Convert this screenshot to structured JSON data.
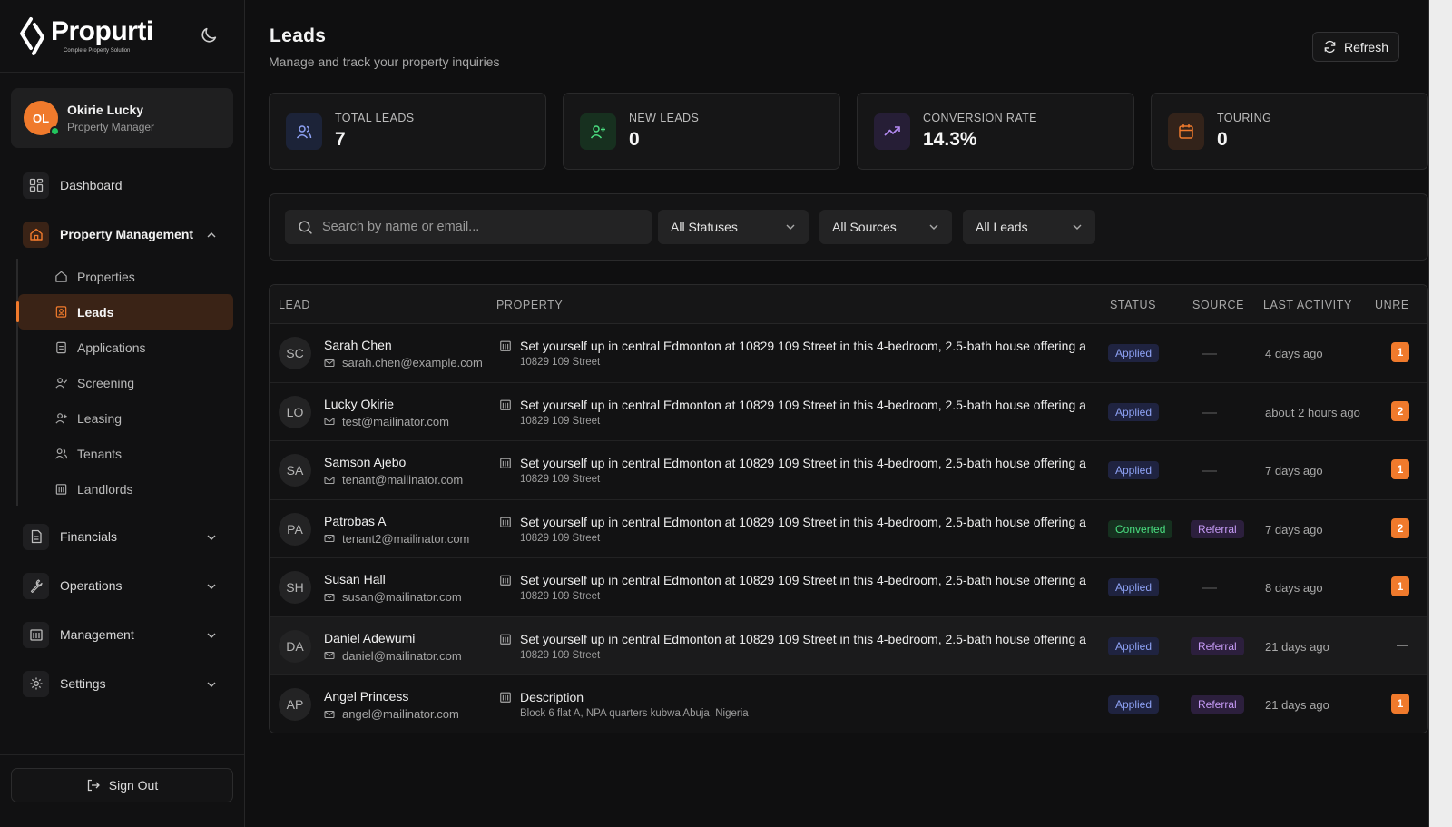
{
  "brand": {
    "name": "Propurti",
    "tagline": "Complete Property Solution"
  },
  "user": {
    "initials": "OL",
    "name": "Okirie Lucky",
    "role": "Property Manager"
  },
  "nav": {
    "dashboard": "Dashboard",
    "property_management": "Property Management",
    "sub": [
      "Properties",
      "Leads",
      "Applications",
      "Screening",
      "Leasing",
      "Tenants",
      "Landlords"
    ],
    "financials": "Financials",
    "operations": "Operations",
    "management": "Management",
    "settings": "Settings",
    "sign_out": "Sign Out"
  },
  "header": {
    "title": "Leads",
    "subtitle": "Manage and track your property inquiries",
    "refresh": "Refresh"
  },
  "stats": [
    {
      "label": "TOTAL LEADS",
      "value": "7",
      "color": "#8ea2f5"
    },
    {
      "label": "NEW LEADS",
      "value": "0",
      "color": "#4ade80"
    },
    {
      "label": "CONVERSION RATE",
      "value": "14.3%",
      "color": "#b68cf5"
    },
    {
      "label": "TOURING",
      "value": "0",
      "color": "#f07a2c"
    }
  ],
  "filters": {
    "search_placeholder": "Search by name or email...",
    "status": "All Statuses",
    "source": "All Sources",
    "leads": "All Leads"
  },
  "table": {
    "columns": [
      "LEAD",
      "PROPERTY",
      "STATUS",
      "SOURCE",
      "LAST ACTIVITY",
      "UNRE"
    ],
    "rows": [
      {
        "initials": "SC",
        "name": "Sarah Chen",
        "email": "sarah.chen@example.com",
        "property": "Set yourself up in central Edmonton at 10829 109 Street in this 4-bedroom, 2.5-bath house offering a",
        "address": "10829 109 Street",
        "status": "Applied",
        "source": "",
        "activity": "4 days ago",
        "unread": "1"
      },
      {
        "initials": "LO",
        "name": "Lucky Okirie",
        "email": "test@mailinator.com",
        "property": "Set yourself up in central Edmonton at 10829 109 Street in this 4-bedroom, 2.5-bath house offering a",
        "address": "10829 109 Street",
        "status": "Applied",
        "source": "",
        "activity": "about 2 hours ago",
        "unread": "2"
      },
      {
        "initials": "SA",
        "name": "Samson Ajebo",
        "email": "tenant@mailinator.com",
        "property": "Set yourself up in central Edmonton at 10829 109 Street in this 4-bedroom, 2.5-bath house offering a",
        "address": "10829 109 Street",
        "status": "Applied",
        "source": "",
        "activity": "7 days ago",
        "unread": "1"
      },
      {
        "initials": "PA",
        "name": "Patrobas A",
        "email": "tenant2@mailinator.com",
        "property": "Set yourself up in central Edmonton at 10829 109 Street in this 4-bedroom, 2.5-bath house offering a",
        "address": "10829 109 Street",
        "status": "Converted",
        "source": "Referral",
        "activity": "7 days ago",
        "unread": "2"
      },
      {
        "initials": "SH",
        "name": "Susan Hall",
        "email": "susan@mailinator.com",
        "property": "Set yourself up in central Edmonton at 10829 109 Street in this 4-bedroom, 2.5-bath house offering a",
        "address": "10829 109 Street",
        "status": "Applied",
        "source": "",
        "activity": "8 days ago",
        "unread": "1"
      },
      {
        "initials": "DA",
        "name": "Daniel Adewumi",
        "email": "daniel@mailinator.com",
        "property": "Set yourself up in central Edmonton at 10829 109 Street in this 4-bedroom, 2.5-bath house offering a",
        "address": "10829 109 Street",
        "status": "Applied",
        "source": "Referral",
        "activity": "21 days ago",
        "unread": "—"
      },
      {
        "initials": "AP",
        "name": "Angel Princess",
        "email": "angel@mailinator.com",
        "property": "Description",
        "address": "Block 6 flat A, NPA quarters kubwa Abuja, Nigeria",
        "status": "Applied",
        "source": "Referral",
        "activity": "21 days ago",
        "unread": "1"
      }
    ]
  },
  "colors": {
    "accent": "#f07a2c",
    "bg": "#0f0f10",
    "online": "#22c55e"
  }
}
